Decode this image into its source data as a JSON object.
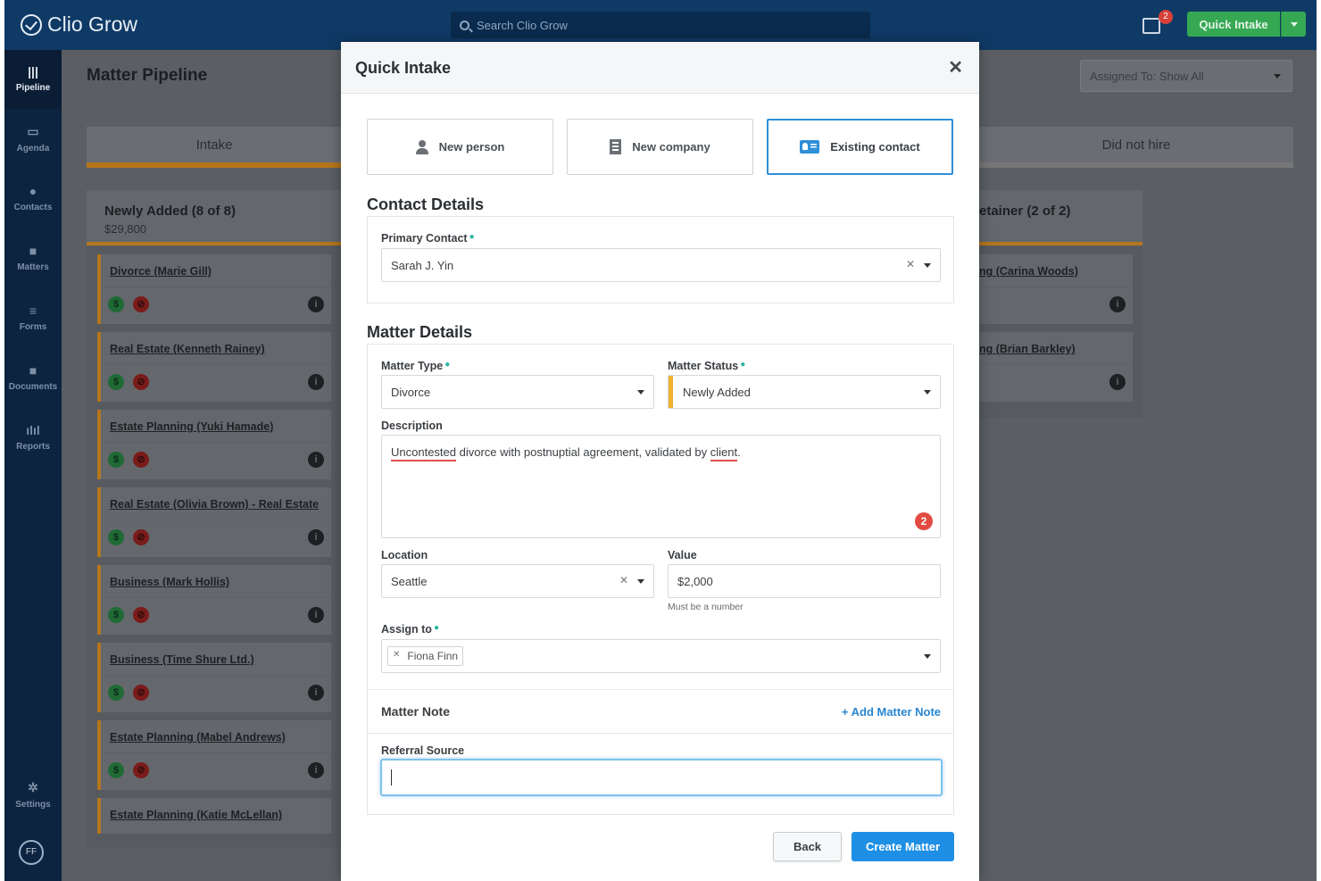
{
  "app": {
    "logo_text": "Clio",
    "logo_bold": "Grow"
  },
  "topbar": {
    "search_placeholder": "Search Clio Grow",
    "notification_count": "2",
    "quick_intake_label": "Quick Intake"
  },
  "sidebar": {
    "items": [
      {
        "label": "Pipeline",
        "icon": "pipeline-icon",
        "glyph": "|||"
      },
      {
        "label": "Agenda",
        "icon": "calendar-icon",
        "glyph": "▭"
      },
      {
        "label": "Contacts",
        "icon": "person-icon",
        "glyph": "●"
      },
      {
        "label": "Matters",
        "icon": "briefcase-icon",
        "glyph": "■"
      },
      {
        "label": "Forms",
        "icon": "list-icon",
        "glyph": "≡"
      },
      {
        "label": "Documents",
        "icon": "folder-icon",
        "glyph": "■"
      },
      {
        "label": "Reports",
        "icon": "bar-chart-icon",
        "glyph": "ılıl"
      },
      {
        "label": "Settings",
        "icon": "gear-icon",
        "glyph": "✲"
      }
    ],
    "avatar": "FF"
  },
  "page": {
    "title": "Matter Pipeline",
    "assigned_filter": "Assigned To: Show All",
    "stages": {
      "intake": "Intake",
      "did_not_hire": "Did not hire"
    },
    "left_column": {
      "title": "Newly Added (8 of 8)",
      "total": "$29,800",
      "cards": [
        "Divorce (Marie Gill)",
        "Real Estate (Kenneth Rainey)",
        "Estate Planning (Yuki Hamade)",
        "Real Estate (Olivia Brown) - Real Estate",
        "Business (Mark Hollis)",
        "Business (Time Shure Ltd.)",
        "Estate Planning (Mabel Andrews)",
        "Estate Planning (Katie McLellan)"
      ]
    },
    "right_column": {
      "title": "etainer (2 of 2)",
      "cards": [
        "ng (Carina Woods)",
        "ng (Brian Barkley)"
      ]
    }
  },
  "modal": {
    "title": "Quick Intake",
    "contact_types": [
      "New person",
      "New company",
      "Existing contact"
    ],
    "contact_section_title": "Contact Details",
    "primary_contact_label": "Primary Contact",
    "primary_contact_value": "Sarah J. Yin",
    "matter_section_title": "Matter Details",
    "matter_type_label": "Matter Type",
    "matter_type_value": "Divorce",
    "matter_status_label": "Matter Status",
    "matter_status_value": "Newly Added",
    "description_label": "Description",
    "description_parts": [
      "Uncontested",
      " divorce with postnuptial agreement, validated by ",
      "client",
      "."
    ],
    "error_count": "2",
    "location_label": "Location",
    "location_value": "Seattle",
    "value_label": "Value",
    "value_value": "$2,000",
    "value_hint": "Must be a number",
    "assign_label": "Assign to",
    "assign_tag": "Fiona Finn",
    "matter_note_label": "Matter Note",
    "add_note_label": "+ Add Matter Note",
    "referral_label": "Referral Source",
    "back_label": "Back",
    "create_label": "Create Matter"
  }
}
